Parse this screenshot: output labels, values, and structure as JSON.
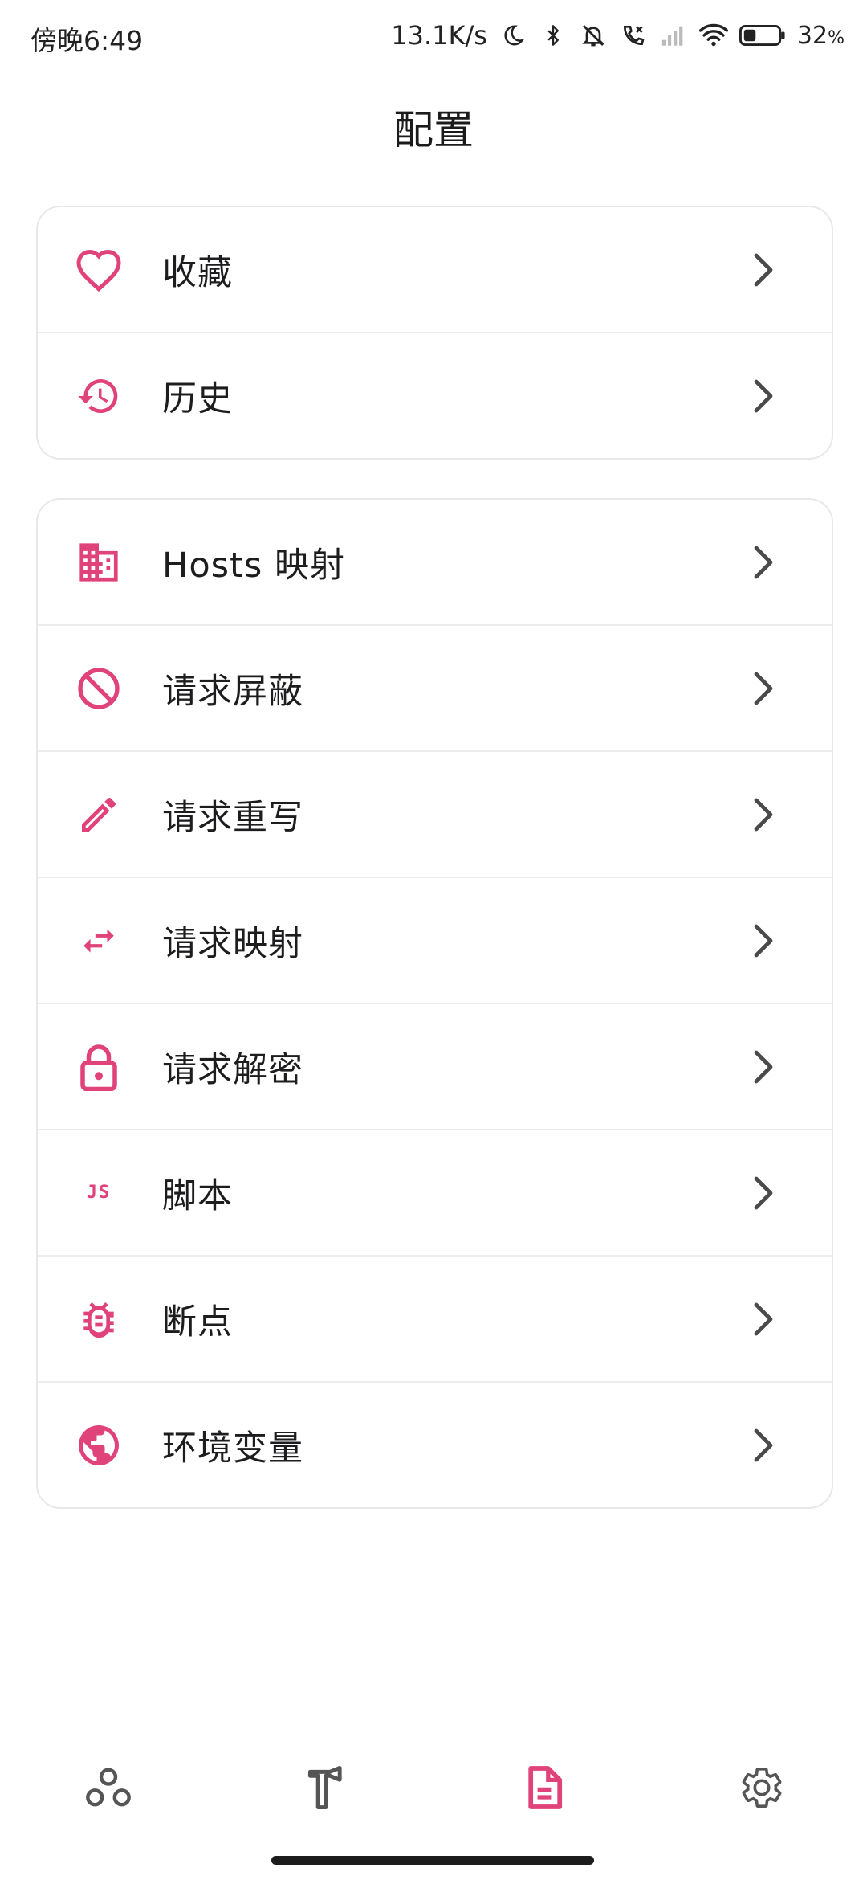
{
  "status_bar": {
    "time": "傍晚6:49",
    "net_speed": "13.1K/s",
    "battery": "32",
    "battery_unit": "%"
  },
  "page": {
    "title": "配置"
  },
  "colors": {
    "accent": "#e0427a",
    "chevron": "#4a4a4a"
  },
  "group1": [
    {
      "label": "收藏",
      "icon": "heart-icon"
    },
    {
      "label": "历史",
      "icon": "history-icon"
    }
  ],
  "group2": [
    {
      "label": "Hosts 映射",
      "icon": "domain-icon"
    },
    {
      "label": "请求屏蔽",
      "icon": "block-icon"
    },
    {
      "label": "请求重写",
      "icon": "pencil-icon"
    },
    {
      "label": "请求映射",
      "icon": "swap-icon"
    },
    {
      "label": "请求解密",
      "icon": "lock-icon"
    },
    {
      "label": "脚本",
      "icon": "js-icon",
      "icon_text": "JS"
    },
    {
      "label": "断点",
      "icon": "bug-icon"
    },
    {
      "label": "环境变量",
      "icon": "globe-icon"
    }
  ],
  "bottom_nav": [
    {
      "icon": "bubble-chart-icon",
      "active": false
    },
    {
      "icon": "hammer-icon",
      "active": false
    },
    {
      "icon": "document-icon",
      "active": true
    },
    {
      "icon": "settings-gear-icon",
      "active": false
    }
  ]
}
